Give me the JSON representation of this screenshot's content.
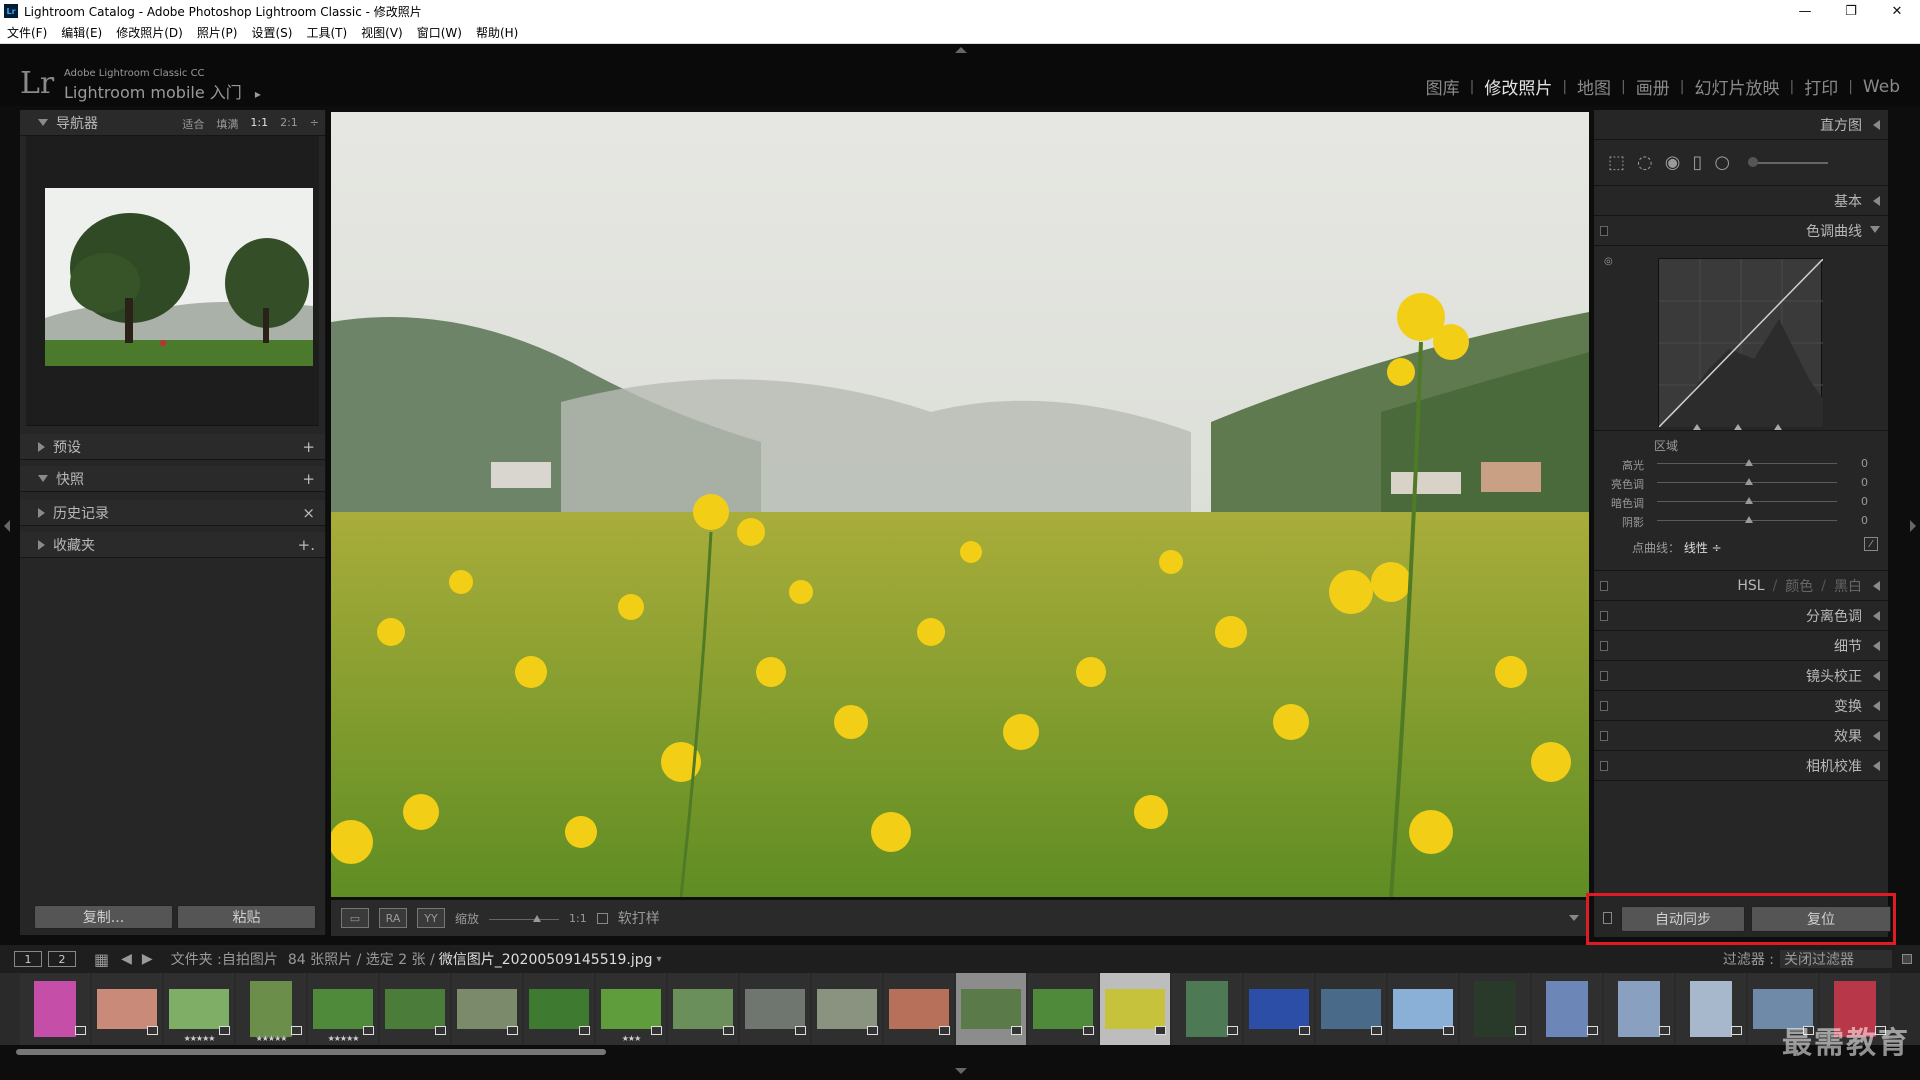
{
  "window": {
    "title": "Lightroom Catalog - Adobe Photoshop Lightroom Classic - 修改照片",
    "app_icon": "Lr",
    "controls": [
      "—",
      "❐",
      "✕"
    ]
  },
  "menu": [
    "文件(F)",
    "编辑(E)",
    "修改照片(D)",
    "照片(P)",
    "设置(S)",
    "工具(T)",
    "视图(V)",
    "窗口(W)",
    "帮助(H)"
  ],
  "identity": {
    "logo": "Lr",
    "small": "Adobe Lightroom Classic CC",
    "big": "Lightroom mobile 入门",
    "arrow": "▸"
  },
  "modules": [
    {
      "label": "图库",
      "active": false
    },
    {
      "label": "修改照片",
      "active": true
    },
    {
      "label": "地图",
      "active": false
    },
    {
      "label": "画册",
      "active": false
    },
    {
      "label": "幻灯片放映",
      "active": false
    },
    {
      "label": "打印",
      "active": false
    },
    {
      "label": "Web",
      "active": false
    }
  ],
  "left": {
    "navigator": {
      "title": "导航器",
      "zoom": [
        "适合",
        "填满",
        "1:1",
        "2:1"
      ],
      "zoom_active": "1:1",
      "zoom_more": "÷"
    },
    "presets": {
      "title": "预设",
      "action": "+"
    },
    "snapshots": {
      "title": "快照",
      "action": "+"
    },
    "history": {
      "title": "历史记录",
      "action": "×"
    },
    "collections": {
      "title": "收藏夹",
      "action": "+."
    },
    "copy": "复制...",
    "paste": "粘贴"
  },
  "toolbar": {
    "zoom_label": "缩放",
    "zoom_value": "1:1",
    "softproof": "软打样",
    "view1": "RA",
    "view2": "YY"
  },
  "right": {
    "histogram": "直方图",
    "basic": "基本",
    "tonecurve": "色调曲线",
    "region": {
      "title": "区域",
      "sliders": [
        {
          "label": "高光",
          "value": "0"
        },
        {
          "label": "亮色调",
          "value": "0"
        },
        {
          "label": "暗色调",
          "value": "0"
        },
        {
          "label": "阴影",
          "value": "0"
        }
      ]
    },
    "pointcurve": {
      "label": "点曲线：",
      "value": "线性 ÷"
    },
    "hsl": {
      "a": "HSL",
      "b": "颜色",
      "c": "黑白",
      "sep": "/"
    },
    "panels": [
      "分离色调",
      "细节",
      "镜头校正",
      "变换",
      "效果",
      "相机校准"
    ],
    "sync": "自动同步",
    "reset": "复位"
  },
  "filmbar": {
    "page1": "1",
    "page2": "2",
    "source": "文件夹 :",
    "folder": "自拍图片",
    "count": "84 张照片 / 选定 2 张 /",
    "filename": "微信图片_20200509145519.jpg",
    "caret": "▾",
    "filter_label": "过滤器 :",
    "filter_value": "关闭过滤器"
  },
  "film": [
    {
      "c": "#c54fa8",
      "stars": "",
      "portrait": true
    },
    {
      "c": "#c98a7a",
      "stars": ""
    },
    {
      "c": "#7fae66",
      "stars": "★★★★★"
    },
    {
      "c": "#6b8f4a",
      "stars": "★★★★★",
      "portrait": true
    },
    {
      "c": "#4e8a3a",
      "stars": "★★★★★"
    },
    {
      "c": "#4c7c3a",
      "stars": ""
    },
    {
      "c": "#7a8a6a",
      "stars": ""
    },
    {
      "c": "#3e7a30",
      "stars": ""
    },
    {
      "c": "#5f9c3b",
      "stars": "★★★"
    },
    {
      "c": "#6a8f5a",
      "stars": ""
    },
    {
      "c": "#6f7670",
      "stars": ""
    },
    {
      "c": "#8a9280",
      "stars": ""
    },
    {
      "c": "#b7705a",
      "stars": ""
    },
    {
      "c": "#5a7a4a",
      "stars": "",
      "sel": 1
    },
    {
      "c": "#4f8a3a",
      "stars": ""
    },
    {
      "c": "#c6c23c",
      "stars": "",
      "sel": 2
    },
    {
      "c": "#4d7a55",
      "stars": "",
      "portrait": true
    },
    {
      "c": "#2d4ea6",
      "stars": ""
    },
    {
      "c": "#4a6a8a",
      "stars": ""
    },
    {
      "c": "#8ab0d8",
      "stars": ""
    },
    {
      "c": "#2a3a2a",
      "stars": "",
      "portrait": true
    },
    {
      "c": "#6c86b8",
      "stars": "",
      "portrait": true
    },
    {
      "c": "#8aa0c0",
      "stars": "",
      "portrait": true
    },
    {
      "c": "#a8b8cc",
      "stars": "",
      "portrait": true
    },
    {
      "c": "#6e8aa8",
      "stars": ""
    },
    {
      "c": "#b8384a",
      "stars": "",
      "portrait": true
    }
  ],
  "watermark": "最需教育"
}
